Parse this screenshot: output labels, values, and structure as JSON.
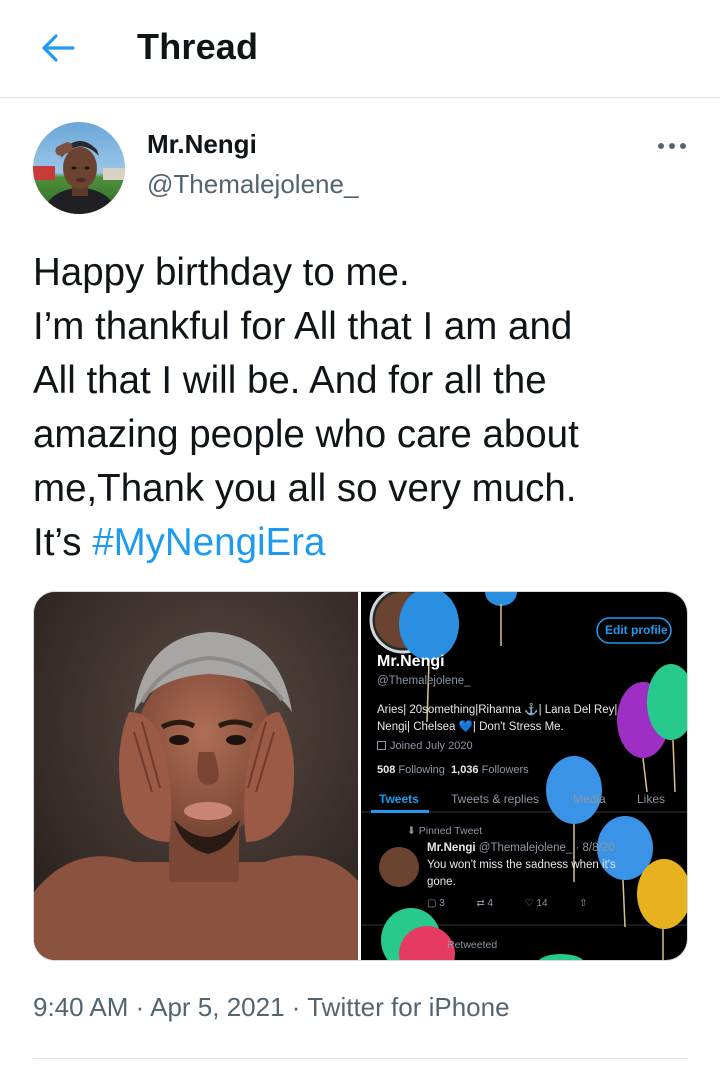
{
  "header": {
    "title": "Thread"
  },
  "tweet": {
    "author_name": "Mr.Nengi",
    "author_handle": "@Themalejolene_",
    "text_lines": [
      "Happy birthday to me.",
      "I’m thankful for All that I am and",
      "All that I will be. And for all the",
      "amazing people who care about",
      "me,Thank you all so very much."
    ],
    "text_last_prefix": "It’s ",
    "hashtag": "#MyNengiEra",
    "time": "9:40 AM",
    "date": "Apr 5, 2021",
    "source": "Twitter for iPhone",
    "separator": "·"
  },
  "embedded_profile": {
    "edit_profile": "Edit profile",
    "name": "Mr.Nengi",
    "handle": "@Themalejolene_",
    "bio_line1": "Aries| 20something|Rihanna ⚓| Lana Del Rey|",
    "bio_line2": "Nengi| Chelsea 💙| Don't Stress Me.",
    "joined": "Joined July 2020",
    "following_count": "508",
    "following_label": "Following",
    "followers_count": "1,036",
    "followers_label": "Followers",
    "tabs": [
      "Tweets",
      "Tweets & replies",
      "Media",
      "Likes"
    ],
    "pinned_label": "Pinned Tweet",
    "pinned_name": "Mr.Nengi",
    "pinned_handle": "@Themalejolene_ · 8/8/20",
    "pinned_text_line1": "You won't miss the sadness when it's",
    "pinned_text_line2": "gone.",
    "replies": "3",
    "retweets": "4",
    "likes": "14",
    "retweeted_label": "Retweeted"
  },
  "colors": {
    "accent": "#1d9bf0",
    "text_primary": "#0f1419",
    "text_secondary": "#536471",
    "divider": "#e1e6ea"
  }
}
